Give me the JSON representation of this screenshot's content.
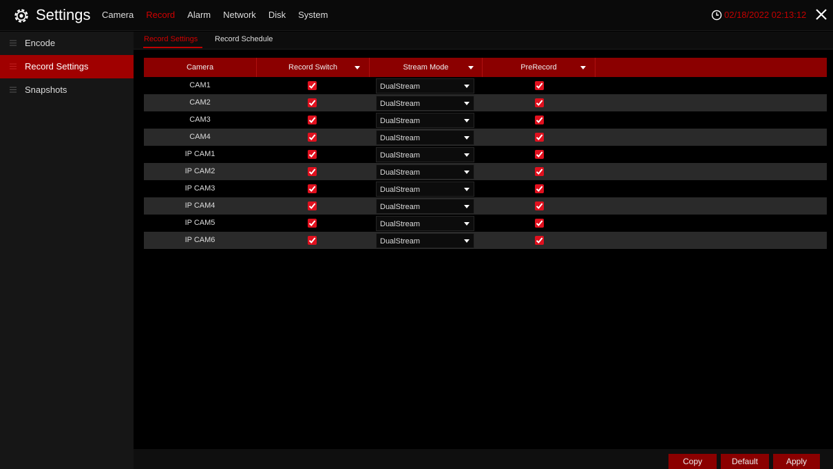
{
  "header": {
    "title": "Settings",
    "gear_icon": "gear-icon",
    "tabs": [
      {
        "label": "Camera",
        "active": false
      },
      {
        "label": "Record",
        "active": true
      },
      {
        "label": "Alarm",
        "active": false
      },
      {
        "label": "Network",
        "active": false
      },
      {
        "label": "Disk",
        "active": false
      },
      {
        "label": "System",
        "active": false
      }
    ],
    "datetime": "02/18/2022 02:13:12",
    "accent_color": "#c40000"
  },
  "sidebar": {
    "items": [
      {
        "label": "Encode",
        "active": false
      },
      {
        "label": "Record Settings",
        "active": true
      },
      {
        "label": "Snapshots",
        "active": false
      }
    ]
  },
  "subtabs": [
    {
      "label": "Record Settings",
      "active": true
    },
    {
      "label": "Record Schedule",
      "active": false
    }
  ],
  "table": {
    "headers": {
      "camera": "Camera",
      "record_switch": "Record Switch",
      "stream_mode": "Stream Mode",
      "prerecord": "PreRecord"
    },
    "rows": [
      {
        "camera": "CAM1",
        "record_switch": true,
        "stream_mode": "DualStream",
        "prerecord": true
      },
      {
        "camera": "CAM2",
        "record_switch": true,
        "stream_mode": "DualStream",
        "prerecord": true
      },
      {
        "camera": "CAM3",
        "record_switch": true,
        "stream_mode": "DualStream",
        "prerecord": true
      },
      {
        "camera": "CAM4",
        "record_switch": true,
        "stream_mode": "DualStream",
        "prerecord": true
      },
      {
        "camera": "IP CAM1",
        "record_switch": true,
        "stream_mode": "DualStream",
        "prerecord": true
      },
      {
        "camera": "IP CAM2",
        "record_switch": true,
        "stream_mode": "DualStream",
        "prerecord": true
      },
      {
        "camera": "IP CAM3",
        "record_switch": true,
        "stream_mode": "DualStream",
        "prerecord": true
      },
      {
        "camera": "IP CAM4",
        "record_switch": true,
        "stream_mode": "DualStream",
        "prerecord": true
      },
      {
        "camera": "IP CAM5",
        "record_switch": true,
        "stream_mode": "DualStream",
        "prerecord": true
      },
      {
        "camera": "IP CAM6",
        "record_switch": true,
        "stream_mode": "DualStream",
        "prerecord": true
      }
    ]
  },
  "footer": {
    "copy_label": "Copy",
    "default_label": "Default",
    "apply_label": "Apply"
  }
}
